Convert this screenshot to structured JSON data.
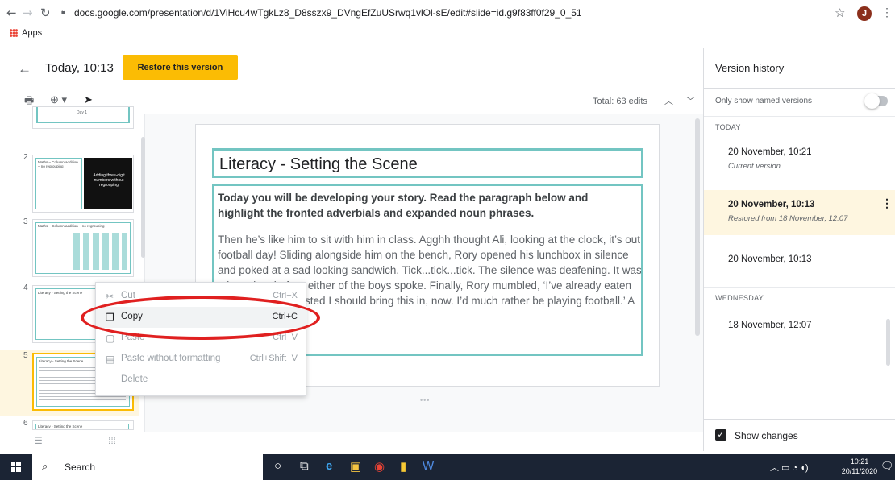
{
  "browser": {
    "url": "docs.google.com/presentation/d/1ViHcu4wTgkLz8_D8sszx9_DVngEfZuUSrwq1vlOl-sE/edit#slide=id.g9f83ff0f29_0_51",
    "profile_initial": "J",
    "bookmarks_apps": "Apps"
  },
  "version_bar": {
    "time": "Today, 10:13",
    "restore_label": "Restore this version",
    "total_edits": "Total: 63 edits"
  },
  "thumbnails": [
    {
      "num": "",
      "title": "Day 1"
    },
    {
      "num": "2",
      "title": "Maths – Column addition – no regrouping",
      "dark_text": "Adding three-digit numbers without regrouping"
    },
    {
      "num": "3",
      "title": "Maths – Column addition – no regrouping"
    },
    {
      "num": "4",
      "title": "Literacy - Setting the Scene"
    },
    {
      "num": "5",
      "title": "Literacy - Setting the Scene"
    },
    {
      "num": "6",
      "title": "Literacy - Setting the Scene"
    }
  ],
  "slide": {
    "title": "Literacy - Setting the Scene",
    "instruction": "Today you will be developing your story. Read the paragraph below and highlight the fronted adverbials and expanded noun phrases.",
    "paragraph": "Then he’s like him to sit with him in class. Agghh thought Ali, looking at the clock, it’s out football day! Sliding alongside him on the bench, Rory opened his lunchbox in silence and poked at a sad looking sandwich. Tick...tick...tick. The silence was deafening. It was a long time before either of the boys spoke. Finally, Rory mumbled, ‘I’ve already eaten lunch. My dad insisted I should bring this in, now. I’d much rather be playing football.’ A grin widened"
  },
  "context_menu": {
    "items": [
      {
        "label": "Cut",
        "shortcut": "Ctrl+X",
        "icon": "scissors-icon",
        "enabled": false
      },
      {
        "label": "Copy",
        "shortcut": "Ctrl+C",
        "icon": "copy-icon",
        "enabled": true
      },
      {
        "label": "Paste",
        "shortcut": "Ctrl+V",
        "icon": "paste-icon",
        "enabled": false
      },
      {
        "label": "Paste without formatting",
        "shortcut": "Ctrl+Shift+V",
        "icon": "paste-plain-icon",
        "enabled": false
      },
      {
        "label": "Delete",
        "shortcut": "",
        "icon": "",
        "enabled": false
      }
    ]
  },
  "version_history": {
    "title": "Version history",
    "toggle_label": "Only show named versions",
    "section_today": "TODAY",
    "section_wednesday": "WEDNESDAY",
    "entries": [
      {
        "date": "20 November, 10:21",
        "sub": "Current version"
      },
      {
        "date": "20 November, 10:13",
        "sub": "Restored from 18 November, 12:07"
      },
      {
        "date": "20 November, 10:13",
        "sub": ""
      },
      {
        "date": "18 November, 12:07",
        "sub": ""
      }
    ],
    "show_changes": "Show changes",
    "show_changes_checked": true
  },
  "taskbar": {
    "search_label": "Search",
    "time": "10:21",
    "date": "20/11/2020"
  },
  "colors": {
    "accent_yellow": "#fbbc04",
    "slide_border_teal": "#73c5c2",
    "annotation_red": "#e02020",
    "taskbar": "#1b2434"
  }
}
